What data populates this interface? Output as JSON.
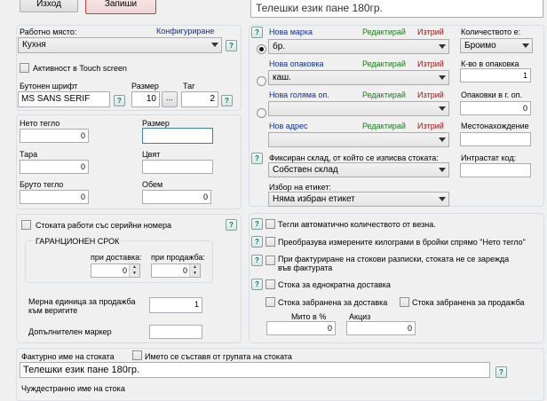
{
  "toolbar": {
    "exit_label": "Изход",
    "save_label": "Запиши"
  },
  "header": {
    "product_name": "Телешки език пане 180гр."
  },
  "workplace": {
    "label": "Работно място:",
    "configure_label": "Конфигуриране",
    "value": "Кухня",
    "touch_label": "Активност в Touch screen"
  },
  "button_font": {
    "label": "Бутонен шрифт",
    "value": "MS SANS SERIF",
    "size_label": "Размер",
    "size_value": "10",
    "browse_label": "...",
    "tag_label": "Таг",
    "tag_value": "2"
  },
  "weights": {
    "net_label": "Нето тегло",
    "net_value": "0",
    "tare_label": "Тара",
    "tare_value": "0",
    "gross_label": "Бруто тегло",
    "gross_value": "0",
    "size_label": "Размер",
    "size_value": "",
    "color_label": "Цвят",
    "color_value": "",
    "volume_label": "Обем",
    "volume_value": "0"
  },
  "serial": {
    "label": "Стоката работи със серийни номера",
    "warranty_title": "ГАРАНЦИОНЕН СРОК",
    "on_delivery_label": "при доставка:",
    "on_delivery_value": "0",
    "on_sale_label": "при продажба:",
    "on_sale_value": "0"
  },
  "chain_unit": {
    "label_line1": "Мерна единица за продажба",
    "label_line2": "към веригите",
    "value": "1",
    "extra_marker_label": "Допълнителен маркер",
    "extra_marker_value": ""
  },
  "brand": {
    "new_brand": "Нова марка",
    "new_package": "Нова опаковка",
    "new_big_package": "Нова голяма оп.",
    "new_address": "Нов адрес",
    "edit": "Редактирай",
    "delete": "Изтрий",
    "brand_value": "бр.",
    "package_value": "каш.",
    "big_package_value": "",
    "address_value": ""
  },
  "quantity": {
    "label": "Количеството е:",
    "value": "Броимо",
    "per_package_label": "К-во в опаковка",
    "per_package_value": "1",
    "packages_label": "Опаковки в г. оп.",
    "packages_value": "0",
    "location_label": "Местонахождение",
    "location_value": "",
    "intrastat_label": "Интрастат код:",
    "intrastat_value": ""
  },
  "warehouse": {
    "label": "Фиксиран склад, от който се изписва стоката:",
    "value": "Собствен склад",
    "tag_label": "Избор на етикет:",
    "tag_value": "Няма избран етикет"
  },
  "options": {
    "auto_scale": "Тегли автоматично количеството от везна.",
    "convert_kg": "Преобразува измерените килограми в бройки спрямо \"Нето тегло\"",
    "invoice_line1": "При фактуриране на стокови разписки, стоката не се зарежда",
    "invoice_line2": "във фактурата",
    "single_delivery": "Стока за еднократна доставка",
    "banned_delivery": "Стока забранена за доставка",
    "banned_sale": "Стока забранена за продажба",
    "duty_label": "Мито в %",
    "duty_value": "0",
    "excise_label": "Акциз",
    "excise_value": "0"
  },
  "invoice_name": {
    "label": "Фактурно име на стоката",
    "group_label": "Името се съставя от групата на стоката",
    "value": "Телешки език пане 180гр.",
    "foreign_label": "Чуждестранно име на стока"
  },
  "icons": {
    "help": "?"
  }
}
